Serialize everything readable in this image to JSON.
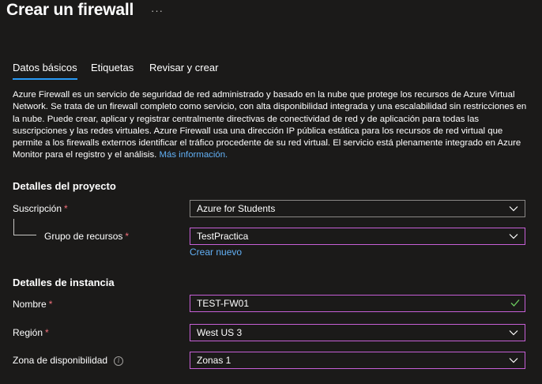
{
  "header": {
    "title": "Crear un firewall",
    "more": "···"
  },
  "tabs": [
    {
      "label": "Datos básicos",
      "active": true
    },
    {
      "label": "Etiquetas",
      "active": false
    },
    {
      "label": "Revisar y crear",
      "active": false
    }
  ],
  "description": {
    "text": "Azure Firewall es un servicio de seguridad de red administrado y basado en la nube que protege los recursos de Azure Virtual Network. Se trata de un firewall completo como servicio, con alta disponibilidad integrada y una escalabilidad sin restricciones en la nube. Puede crear, aplicar y registrar centralmente directivas de conectividad de red y de aplicación para todas las suscripciones y las redes virtuales. Azure Firewall usa una dirección IP pública estática para los recursos de red virtual que permite a los firewalls externos identificar el tráfico procedente de su red virtual. El servicio está plenamente integrado en Azure Monitor para el registro y el análisis.",
    "link": "Más información."
  },
  "project": {
    "heading": "Detalles del proyecto",
    "subscription": {
      "label": "Suscripción",
      "required": "*",
      "value": "Azure for Students"
    },
    "resource_group": {
      "label": "Grupo de recursos",
      "required": "*",
      "value": "TestPractica",
      "create_new": "Crear nuevo"
    }
  },
  "instance": {
    "heading": "Detalles de instancia",
    "name": {
      "label": "Nombre",
      "required": "*",
      "value": "TEST-FW01"
    },
    "region": {
      "label": "Región",
      "required": "*",
      "value": "West US 3"
    },
    "zone": {
      "label": "Zona de disponibilidad",
      "info": "i",
      "value": "Zonas 1"
    }
  },
  "colors": {
    "background": "#1b1a19",
    "accent": "#2899f5",
    "link": "#62b0f5",
    "focus_border": "#c65fd6",
    "required": "#f1707b",
    "valid_check": "#6ccb5f"
  },
  "icons": {
    "dropdown": "chevron-down-icon",
    "valid": "checkmark-icon",
    "info": "info-icon",
    "more": "more-icon"
  }
}
